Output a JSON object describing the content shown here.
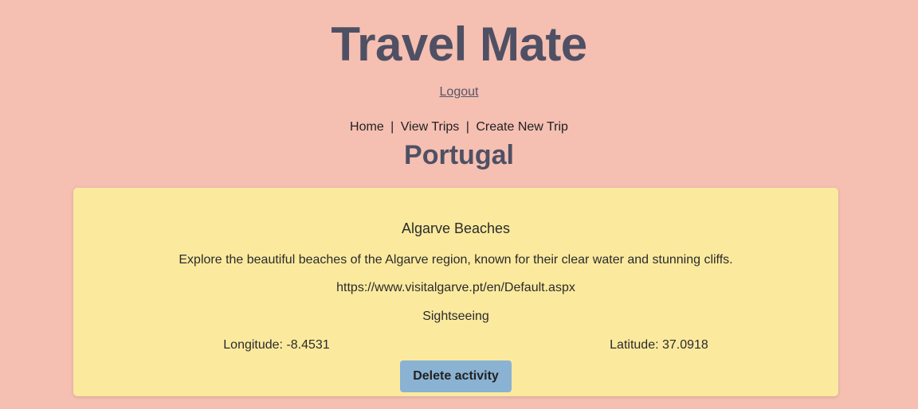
{
  "header": {
    "app_title": "Travel Mate",
    "logout_label": "Logout"
  },
  "nav": {
    "home": "Home",
    "separator": "|",
    "view_trips": "View Trips",
    "create_trip": "Create New Trip"
  },
  "page": {
    "title": "Portugal"
  },
  "activity": {
    "name": "Algarve Beaches",
    "description": "Explore the beautiful beaches of the Algarve region, known for their clear water and stunning cliffs.",
    "url": "https://www.visitalgarve.pt/en/Default.aspx",
    "category": "Sightseeing",
    "longitude_label": "Longitude: -8.4531",
    "latitude_label": "Latitude: 37.0918",
    "delete_label": "Delete activity"
  },
  "colors": {
    "background": "#f5bfb2",
    "card": "#fbea9e",
    "button": "#8ab2d2",
    "title": "#4f5063"
  }
}
